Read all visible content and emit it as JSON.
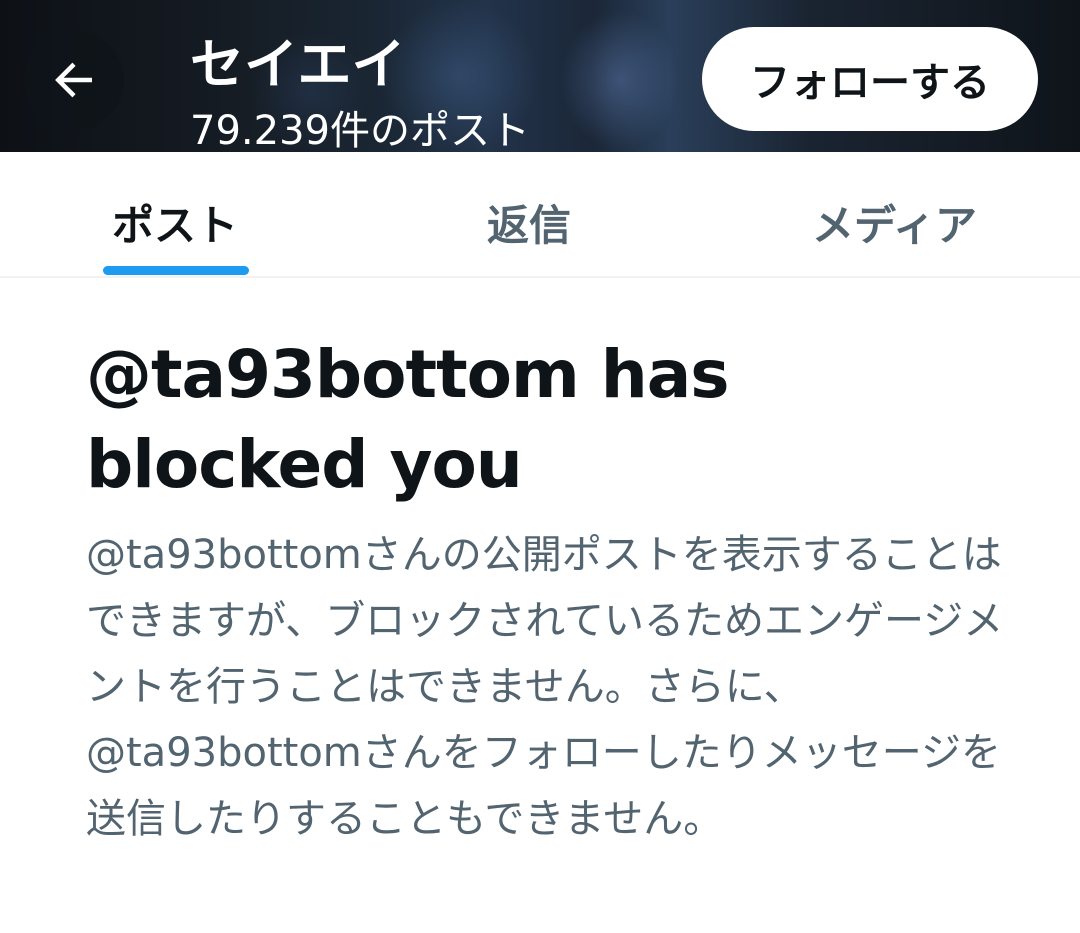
{
  "header": {
    "profile_name": "セイエイ",
    "post_count": "79.239件のポスト",
    "follow_label": "フォローする"
  },
  "tabs": [
    {
      "label": "ポスト",
      "active": true
    },
    {
      "label": "返信",
      "active": false
    },
    {
      "label": "メディア",
      "active": false
    }
  ],
  "blocked": {
    "title": "@ta93bottom has blocked you",
    "description": "@ta93bottomさんの公開ポストを表示することはできますが、ブロックされているためエンゲージメントを行うことはできません。さらに、@ta93bottomさんをフォローしたりメッセージを送信したりすることもできません。"
  },
  "colors": {
    "accent": "#1d9bf0",
    "primary_text": "#0f1419",
    "secondary_text": "#536471"
  },
  "icons": {
    "back": "arrow-left-icon"
  }
}
